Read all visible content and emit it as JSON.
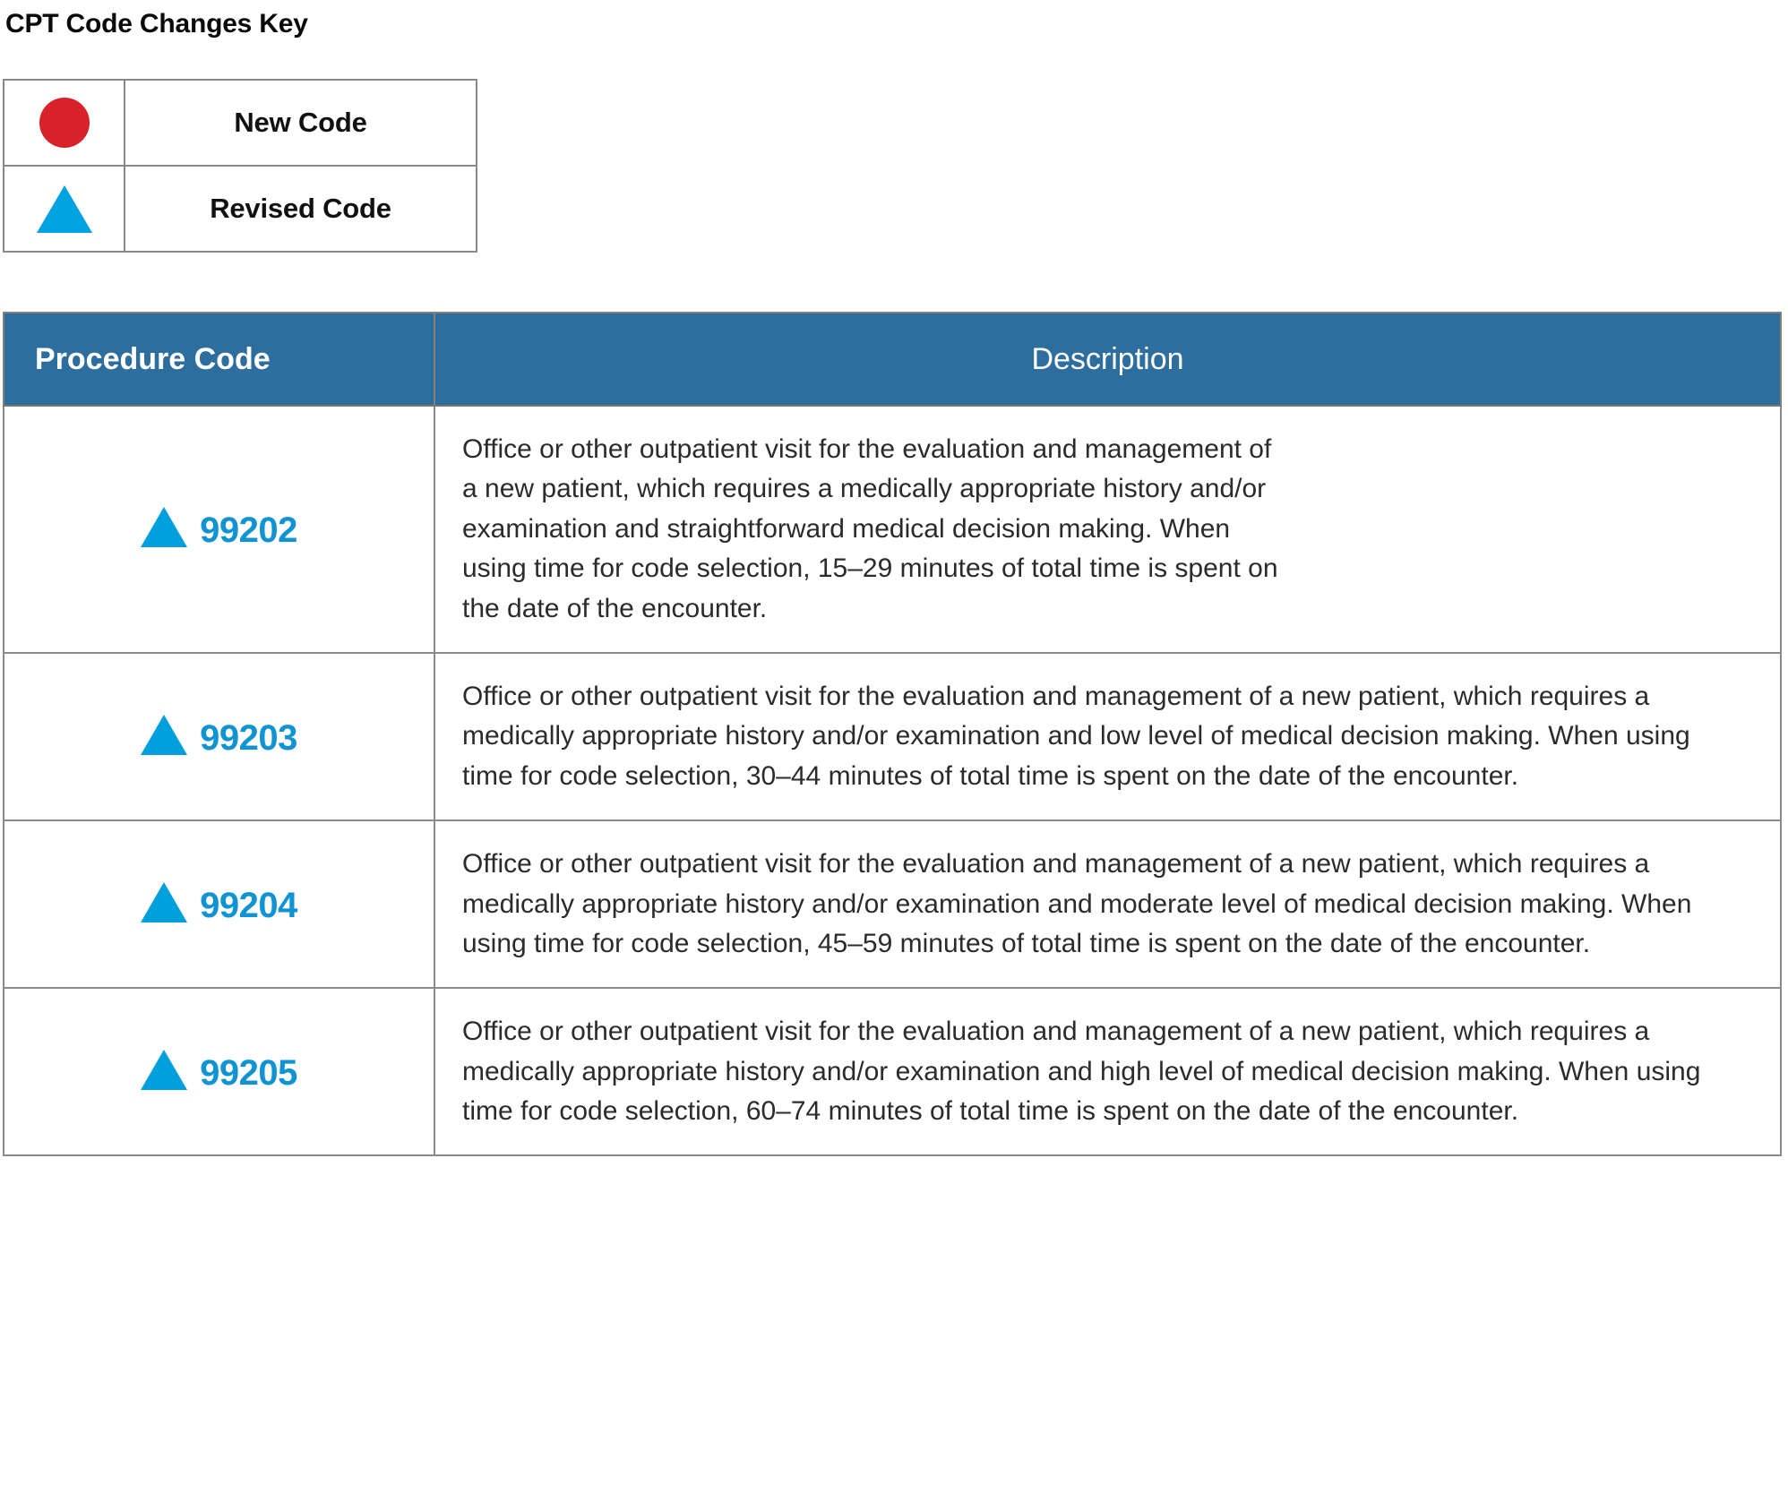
{
  "key": {
    "title": "CPT Code Changes Key",
    "items": [
      {
        "symbol": "circle",
        "symbol_name": "new-code-circle-icon",
        "color": "#d8222a",
        "label": "New Code"
      },
      {
        "symbol": "triangle",
        "symbol_name": "revised-code-triangle-icon",
        "color": "#00a3e0",
        "label": "Revised Code"
      }
    ]
  },
  "table": {
    "accent_color": "#2e6e9e",
    "marker_blue": "#00a0dd",
    "marker_red": "#d8222a",
    "columns": [
      {
        "label": "Procedure Code"
      },
      {
        "label": "Description"
      }
    ],
    "rows": [
      {
        "marker": "triangle",
        "code": "99202",
        "description": "Office or other outpatient visit for the evaluation and management of a new patient, which requires a medically appropriate history and/or examination and straightforward medical decision making. When using time for code selection, 15–29 minutes of total time is spent on the date of the encounter."
      },
      {
        "marker": "triangle",
        "code": "99203",
        "description": "Office or other outpatient visit for the evaluation and management of a new patient, which requires a medically appropriate history and/or examination and low level of medical decision making. When using time for code selection, 30–44 minutes of total time is spent on the date of the encounter."
      },
      {
        "marker": "triangle",
        "code": "99204",
        "description": "Office or other outpatient visit for the evaluation and management of a new patient, which requires a medically appropriate history and/or examination and moderate level of medical decision making. When using time for code selection, 45–59 minutes of total time is spent on the date of the encounter."
      },
      {
        "marker": "triangle",
        "code": "99205",
        "description": "Office or other outpatient visit for the evaluation and management of a new patient, which requires a medically appropriate history and/or examination and high level of medical decision making. When using time for code selection, 60–74 minutes of total time is spent on the date of the encounter."
      }
    ]
  }
}
